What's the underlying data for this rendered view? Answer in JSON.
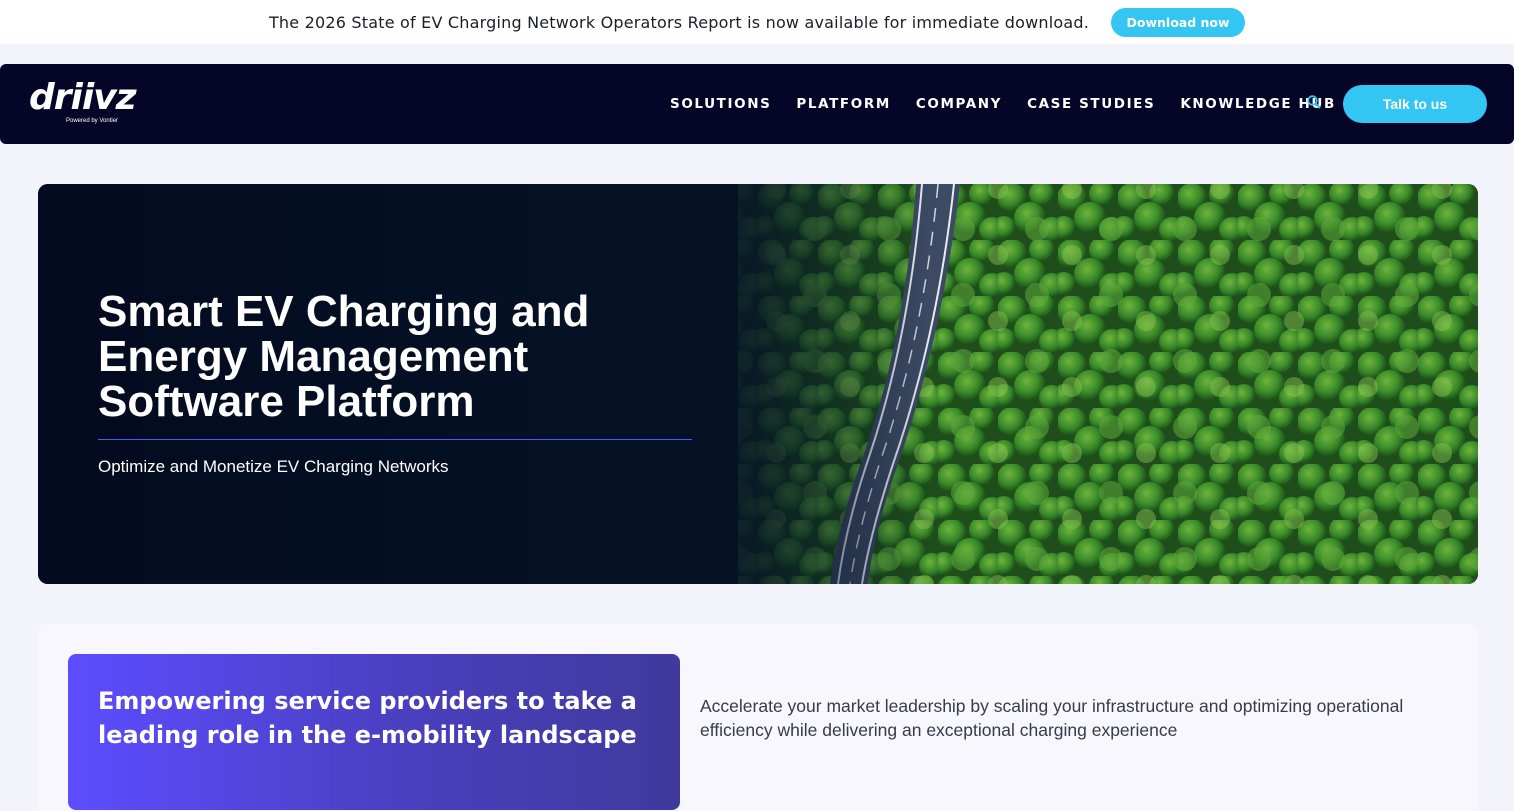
{
  "announcement": {
    "text": "The 2026 State of EV Charging Network Operators Report is now available for immediate download.",
    "button_label": "Download now"
  },
  "header": {
    "logo_text": "driivz",
    "logo_tagline": "Powered by Vontier",
    "nav": [
      {
        "label": "SOLUTIONS"
      },
      {
        "label": "PLATFORM"
      },
      {
        "label": "COMPANY"
      },
      {
        "label": "CASE STUDIES"
      },
      {
        "label": "KNOWLEDGE HUB"
      }
    ],
    "search_icon": "search-icon",
    "cta_label": "Talk to us"
  },
  "hero": {
    "title": "Smart EV Charging and Energy Management Software Platform",
    "subtitle": "Optimize and Monetize EV Charging Networks",
    "image": "aerial-forest-road"
  },
  "feature": {
    "heading": "Empowering service providers to take a leading role in the e-mobility landscape",
    "text": "Accelerate your market leadership by scaling your infrastructure and optimizing operational efficiency while delivering an exceptional charging experience"
  },
  "colors": {
    "accent": "#34c6f2",
    "nav_bg": "#050627",
    "page_bg": "#f3f3fb",
    "feature_gradient_start": "#5c4dff",
    "feature_gradient_end": "#3f3a9c"
  }
}
